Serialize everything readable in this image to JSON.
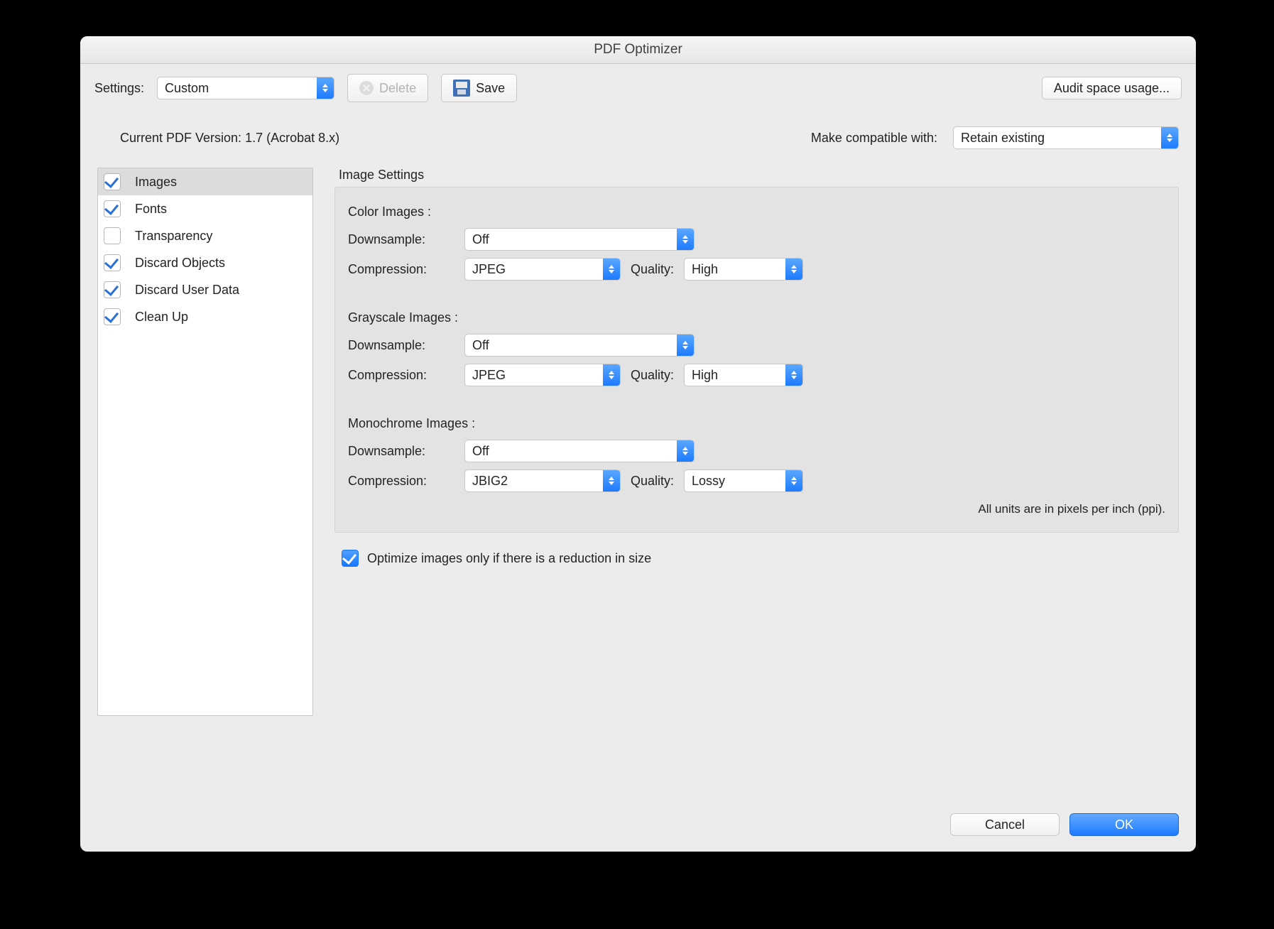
{
  "title": "PDF Optimizer",
  "toolbar": {
    "settings_label": "Settings:",
    "settings_value": "Custom",
    "delete_label": "Delete",
    "save_label": "Save",
    "audit_label": "Audit space usage..."
  },
  "version_line": "Current PDF Version: 1.7 (Acrobat 8.x)",
  "compat": {
    "label": "Make compatible with:",
    "value": "Retain existing"
  },
  "sidebar": {
    "items": [
      {
        "label": "Images",
        "checked": true,
        "selected": true
      },
      {
        "label": "Fonts",
        "checked": true,
        "selected": false
      },
      {
        "label": "Transparency",
        "checked": false,
        "selected": false
      },
      {
        "label": "Discard Objects",
        "checked": true,
        "selected": false
      },
      {
        "label": "Discard User Data",
        "checked": true,
        "selected": false
      },
      {
        "label": "Clean Up",
        "checked": true,
        "selected": false
      }
    ]
  },
  "main": {
    "section_title": "Image Settings",
    "labels": {
      "downsample": "Downsample:",
      "compression": "Compression:",
      "quality": "Quality:"
    },
    "color": {
      "title": "Color Images :",
      "downsample": "Off",
      "compression": "JPEG",
      "quality": "High"
    },
    "gray": {
      "title": "Grayscale Images :",
      "downsample": "Off",
      "compression": "JPEG",
      "quality": "High"
    },
    "mono": {
      "title": "Monochrome Images :",
      "downsample": "Off",
      "compression": "JBIG2",
      "quality": "Lossy"
    },
    "units_note": "All units are in pixels per inch (ppi).",
    "optimize_only_if_reduction": "Optimize images only if there is a reduction in size"
  },
  "buttons": {
    "cancel": "Cancel",
    "ok": "OK"
  }
}
